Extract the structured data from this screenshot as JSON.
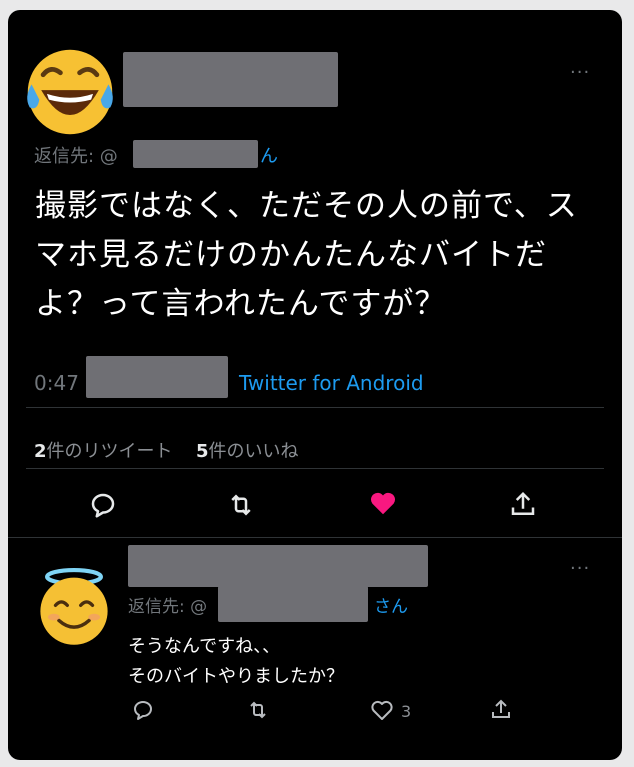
{
  "tweet": {
    "reply_label": "返信先: @",
    "reply_suffix": "ん",
    "text_lines": [
      "撮影ではなく、ただその人の前で、ス",
      "マホ見るだけのかんたんなバイトだ",
      "よ？って言われたんですが？"
    ],
    "time": "0:47",
    "source": "Twitter for Android",
    "retweets_count": "2",
    "retweets_label": "件のリツイート",
    "likes_count": "5",
    "likes_label": "件のいいね",
    "liked": true
  },
  "reply": {
    "reply_label": "返信先: @",
    "reply_suffix": "さん",
    "text_lines": [
      "そうなんですね、、",
      "そのバイトやりましたか？"
    ],
    "like_count": "3"
  },
  "icons": {
    "avatar1": "laughing-tears-emoji",
    "avatar2": "smiling-halo-emoji",
    "more": "more-dots-icon",
    "reply": "reply-icon",
    "retweet": "retweet-icon",
    "like": "heart-icon",
    "share": "share-icon"
  },
  "colors": {
    "background": "#000000",
    "accent": "#1d9bf0",
    "like": "#f91880",
    "muted": "#71767b"
  }
}
